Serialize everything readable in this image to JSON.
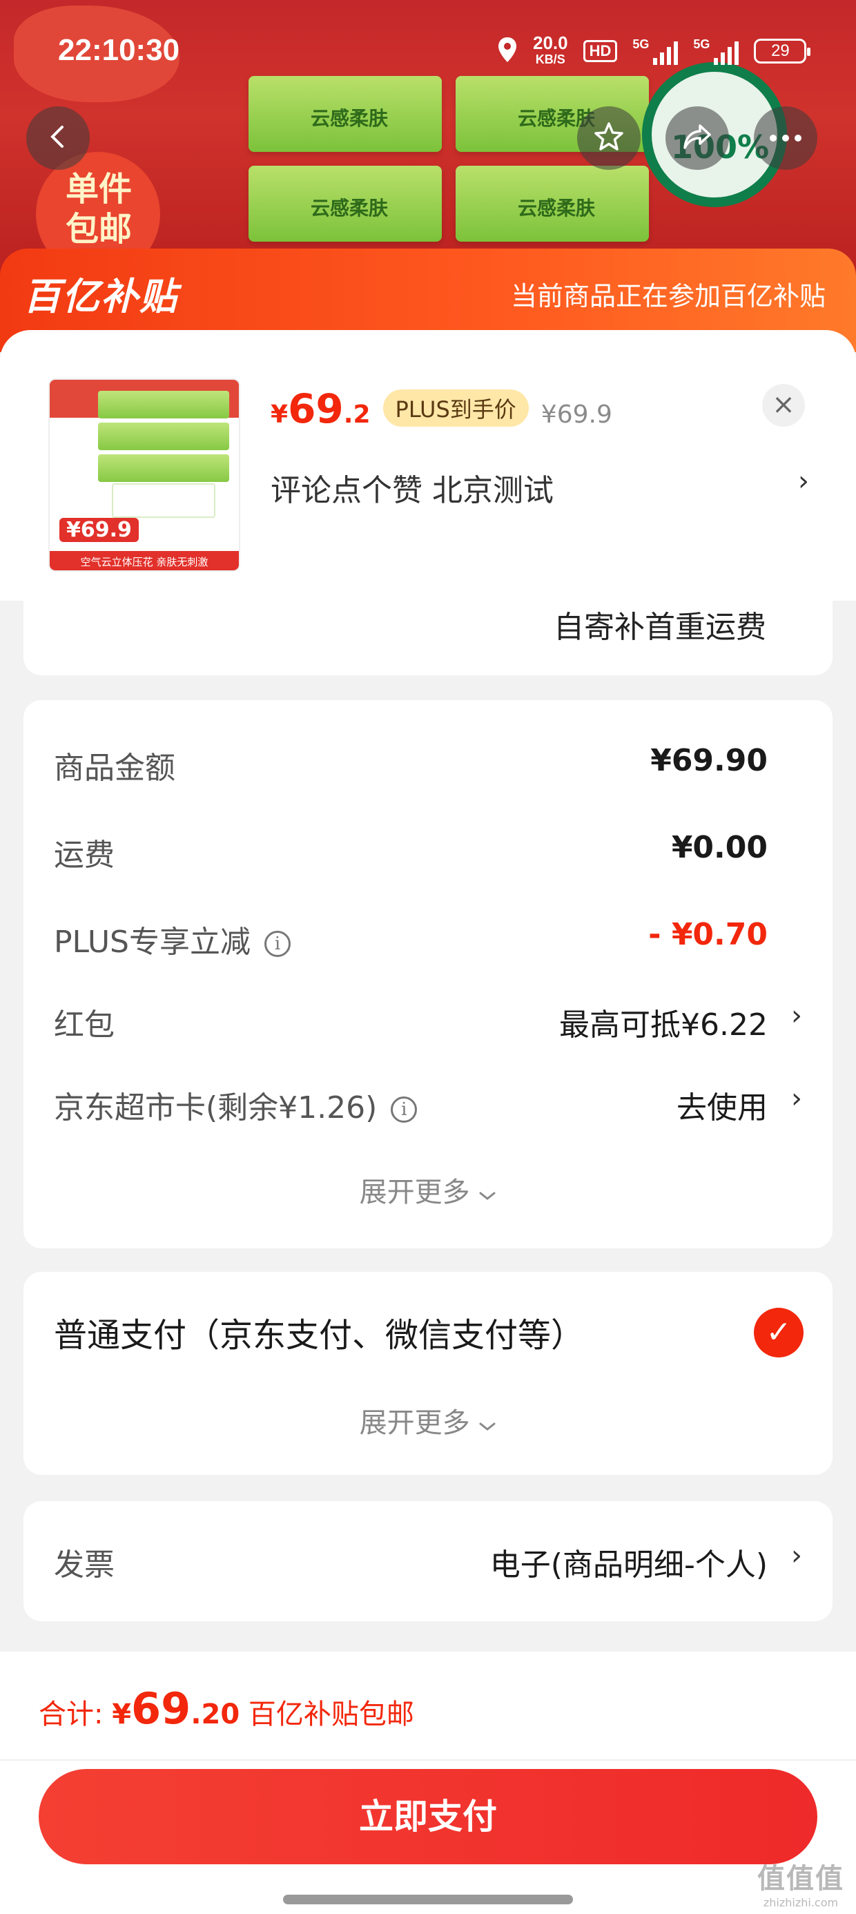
{
  "status_bar": {
    "time": "22:10:30",
    "net_speed": "20.0",
    "net_unit": "KB/S",
    "hd": "HD",
    "signal1_label": "5G",
    "signal2_label": "5G",
    "battery": "29"
  },
  "hero": {
    "badge_text": "单件包邮",
    "box_label": "云感柔肤",
    "tree_percent": "100%"
  },
  "subsidy_banner": {
    "logo": "百亿补贴",
    "note": "当前商品正在参加百亿补贴"
  },
  "product": {
    "price_currency": "¥",
    "price_int": "69",
    "price_dec": ".2",
    "plus_tag": "PLUS到手价",
    "original_price": "¥69.9",
    "variant": "评论点个赞  北京测试",
    "thumb_price": "¥69.9",
    "thumb_strip": "空气云立体压花 亲肤无刺激"
  },
  "shipping": {
    "text": "自寄补首重运费"
  },
  "fees": {
    "goods_label": "商品金额",
    "goods_value": "¥69.90",
    "freight_label": "运费",
    "freight_value": "¥0.00",
    "plus_label": "PLUS专享立减",
    "plus_value": "- ¥0.70",
    "redpacket_label": "红包",
    "redpacket_value": "最高可抵¥6.22",
    "card_label": "京东超市卡(剩余¥1.26)",
    "card_value": "去使用",
    "expand_label": "展开更多"
  },
  "payment": {
    "method": "普通支付（京东支付、微信支付等）",
    "expand_label": "展开更多"
  },
  "invoice": {
    "label": "发票",
    "value": "电子(商品明细-个人)"
  },
  "footer": {
    "total_prefix": "合计: ",
    "total_currency": "¥",
    "total_int": "69",
    "total_dec": ".20",
    "total_note": " 百亿补贴包邮",
    "pay_button": "立即支付"
  },
  "watermark": {
    "mark": "值值值",
    "url": "zhizhizhi.com"
  },
  "icons": [
    "back-icon",
    "star-icon",
    "share-icon",
    "more-icon",
    "close-icon",
    "info-icon",
    "chevron-right-icon",
    "chevron-down-icon",
    "check-icon",
    "location-icon"
  ],
  "colors": {
    "accent_red": "#f2270c",
    "subsidy_orange": "#ff5a1f",
    "plus_gold": "#ffe7a8",
    "page_bg": "#f2f2f2"
  }
}
